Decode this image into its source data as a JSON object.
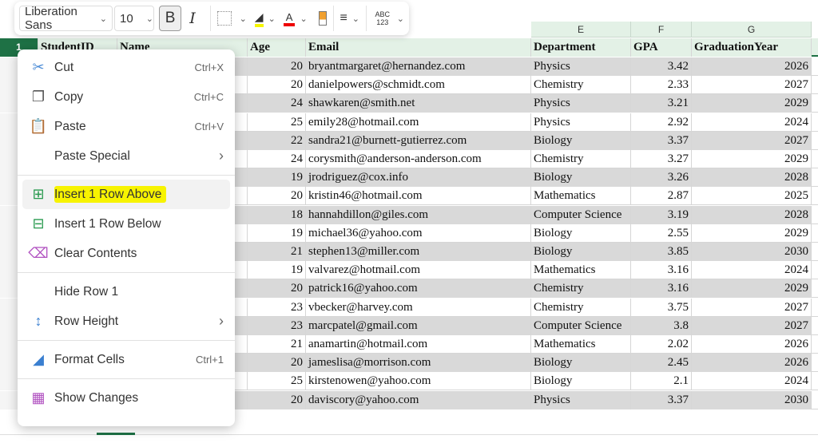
{
  "toolbar": {
    "font": "Liberation Sans",
    "size": "10",
    "bold": "B",
    "italic": "I",
    "number_format": "ABC 123"
  },
  "columns": [
    "E",
    "F",
    "G"
  ],
  "header_row_number": "1",
  "headers": [
    "StudentID",
    "Name",
    "Age",
    "Email",
    "Department",
    "GPA",
    "GraduationYear"
  ],
  "rows": [
    [
      "20",
      "bryantmargaret@hernandez.com",
      "Physics",
      "3.42",
      "2026"
    ],
    [
      "20",
      "danielpowers@schmidt.com",
      "Chemistry",
      "2.33",
      "2027"
    ],
    [
      "24",
      "shawkaren@smith.net",
      "Physics",
      "3.21",
      "2029"
    ],
    [
      "25",
      "emily28@hotmail.com",
      "Physics",
      "2.92",
      "2024"
    ],
    [
      "22",
      "sandra21@burnett-gutierrez.com",
      "Biology",
      "3.37",
      "2027"
    ],
    [
      "24",
      "corysmith@anderson-anderson.com",
      "Chemistry",
      "3.27",
      "2029"
    ],
    [
      "19",
      "jrodriguez@cox.info",
      "Biology",
      "3.26",
      "2028"
    ],
    [
      "20",
      "kristin46@hotmail.com",
      "Mathematics",
      "2.87",
      "2025"
    ],
    [
      "18",
      "hannahdillon@giles.com",
      "Computer Science",
      "3.19",
      "2028"
    ],
    [
      "19",
      "michael36@yahoo.com",
      "Biology",
      "2.55",
      "2029"
    ],
    [
      "21",
      "stephen13@miller.com",
      "Biology",
      "3.85",
      "2030"
    ],
    [
      "19",
      "valvarez@hotmail.com",
      "Mathematics",
      "3.16",
      "2024"
    ],
    [
      "20",
      "patrick16@yahoo.com",
      "Chemistry",
      "3.16",
      "2029"
    ],
    [
      "23",
      "vbecker@harvey.com",
      "Chemistry",
      "3.75",
      "2027"
    ],
    [
      "23",
      "marcpatel@gmail.com",
      "Computer Science",
      "3.8",
      "2027"
    ],
    [
      "21",
      "anamartin@hotmail.com",
      "Mathematics",
      "2.02",
      "2026"
    ],
    [
      "20",
      "jameslisa@morrison.com",
      "Biology",
      "2.45",
      "2026"
    ],
    [
      "25",
      "kirstenowen@yahoo.com",
      "Biology",
      "2.1",
      "2024"
    ],
    [
      "20",
      "daviscory@yahoo.com",
      "Physics",
      "3.37",
      "2030"
    ]
  ],
  "menu": [
    {
      "label": "Cut",
      "shortcut": "Ctrl+X",
      "icon": "scissors-icon"
    },
    {
      "label": "Copy",
      "shortcut": "Ctrl+C",
      "icon": "copy-icon"
    },
    {
      "label": "Paste",
      "shortcut": "Ctrl+V",
      "icon": "paste-icon"
    },
    {
      "label": "Paste Special",
      "icon": "chevron-right-icon"
    },
    {
      "label": "Insert 1 Row Above",
      "icon": "insert-row-above-icon",
      "highlighted": true
    },
    {
      "label": "Insert 1 Row Below",
      "icon": "insert-row-below-icon"
    },
    {
      "label": "Clear Contents",
      "icon": "eraser-icon"
    },
    {
      "label": "Hide Row 1"
    },
    {
      "label": "Row Height",
      "icon": "row-height-icon"
    },
    {
      "label": "Format Cells",
      "shortcut": "Ctrl+1",
      "icon": "format-cells-icon"
    },
    {
      "label": "Show Changes",
      "icon": "show-changes-icon"
    }
  ],
  "colors": {
    "accent": "#1e7145",
    "highlight": "#f7f300",
    "row_band": "#d9d9d9"
  }
}
